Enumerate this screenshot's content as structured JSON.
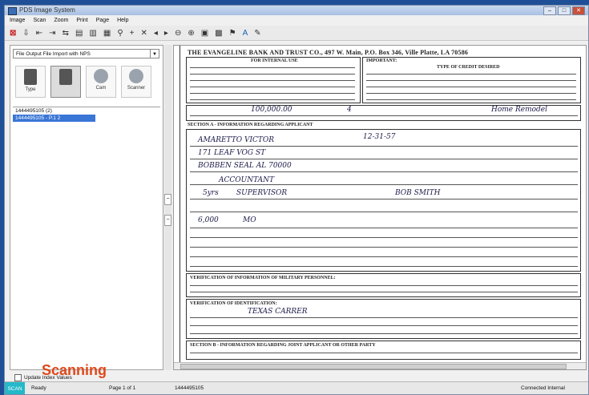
{
  "window": {
    "title": "PDS Image System"
  },
  "menu": [
    "Image",
    "Scan",
    "Zoom",
    "Print",
    "Page",
    "Help"
  ],
  "toolbar_icons": [
    "close-icon",
    "save-icon",
    "prev-icon",
    "next-icon",
    "first-icon",
    "last-icon",
    "rotate-icon",
    "scan-icon",
    "zoom-icon",
    "add-icon",
    "delete-icon",
    "page-prev-icon",
    "page-next-icon",
    "fit-icon",
    "fit-width-icon",
    "grid-icon",
    "thumbnails-icon",
    "flag-icon",
    "text-icon",
    "edit-icon"
  ],
  "left_panel": {
    "dropdown": "File Output File Import with NPS",
    "source_buttons": [
      "Type",
      "",
      "Cam",
      "Scanner"
    ],
    "tree_items": [
      "1444495105 (2)",
      "1444495105 - P.1 2"
    ],
    "overlay_label": "Scanning",
    "checkbox_label": "Update Index Values"
  },
  "document": {
    "bank_title": "THE EVANGELINE BANK AND TRUST CO., 497 W. Main, P.O. Box 346, Ville Platte, LA 70586",
    "internal_use": "FOR INTERNAL USE",
    "important": "IMPORTANT:",
    "credit_type": "TYPE OF CREDIT DESIRED",
    "section_a": "SECTION A - INFORMATION REGARDING APPLICANT",
    "military": "VERIFICATION OF INFORMATION OF MILITARY PERSONNEL:",
    "identification": "VERIFICATION OF IDENTIFICATION:",
    "section_b": "SECTION B - INFORMATION REGARDING JOINT APPLICANT OR OTHER PARTY",
    "handwriting": {
      "amount": "100,000.00",
      "term": "4",
      "purpose": "Home Remodel",
      "name": "AMARETTO VICTOR",
      "dob": "12-31-57",
      "street": "171 LEAF VOG ST",
      "city": "BOBBEN SEAL AL 70000",
      "employer": "ACCOUNTANT",
      "years": "5yrs",
      "position": "SUPERVISOR",
      "supervisor": "BOB SMITH",
      "income1": "6,000",
      "income2": "MO",
      "field2": "TEXAS CARRER"
    }
  },
  "status": {
    "mode": "SCAN",
    "state": "Ready",
    "page": "Page 1 of 1",
    "doc_id": "1444495105",
    "connection": "Connected Internal"
  }
}
